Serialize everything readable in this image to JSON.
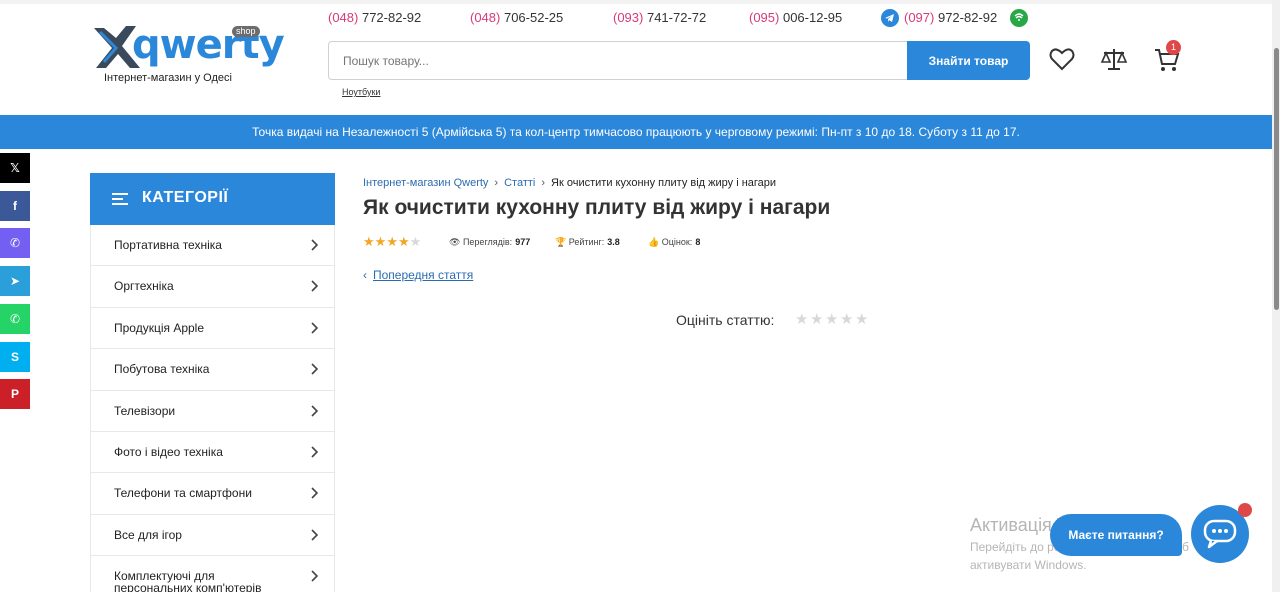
{
  "header": {
    "logo_text": "qwerty",
    "logo_badge": "shop",
    "logo_tagline": "Інтернет-магазин у Одесі",
    "phones": [
      {
        "code": "(048)",
        "number": " 772-82-92"
      },
      {
        "code": "(048)",
        "number": " 706-52-25"
      },
      {
        "code": "(093)",
        "number": " 741-72-72"
      },
      {
        "code": "(095)",
        "number": " 006-12-95"
      },
      {
        "code": "(097)",
        "number": " 972-82-92"
      }
    ],
    "search_placeholder": "Пошук товару...",
    "search_button": "Знайти товар",
    "search_hint": "Ноутбуки",
    "cart_count": "1",
    "icons": [
      "heart-icon",
      "compare-scales-icon",
      "cart-icon",
      "telegram-icon",
      "viber-icon"
    ]
  },
  "banner": "Точка видачі на Незалежності 5 (Армійська 5) та кол-центр тимчасово працюють у черговому режимі: Пн-пт з 10 до 18. Суботу з 11 до 17.",
  "share": [
    {
      "icon": "x-icon",
      "glyph": "𝕏",
      "color": "#000000"
    },
    {
      "icon": "facebook-icon",
      "glyph": "f",
      "color": "#3b5998"
    },
    {
      "icon": "viber-icon",
      "glyph": "✆",
      "color": "#7360f2"
    },
    {
      "icon": "telegram-icon",
      "glyph": "➤",
      "color": "#2b9fd9"
    },
    {
      "icon": "whatsapp-icon",
      "glyph": "✆",
      "color": "#25d366"
    },
    {
      "icon": "skype-icon",
      "glyph": "S",
      "color": "#00aff0"
    },
    {
      "icon": "pinterest-icon",
      "glyph": "P",
      "color": "#cb2027"
    }
  ],
  "categories": {
    "title": "КАТЕГОРІЇ",
    "items": [
      "Портативна техніка",
      "Оргтехніка",
      "Продукція Apple",
      "Побутова техніка",
      "Телевізори",
      "Фото і відео техніка",
      "Телефони та смартфони",
      "Все для ігор",
      "Комплектуючі для персональних комп'ютерів"
    ]
  },
  "breadcrumbs": [
    "Інтернет-магазин Qwerty",
    "Статті",
    "Як очистити кухонну плиту від жиру і нагари"
  ],
  "article": {
    "title": "Як очистити кухонну плиту від жиру і нагари",
    "rating_stars": 4,
    "views_label": "Переглядів:",
    "views": "977",
    "rating_label": "Рейтинг:",
    "rating": "3.8",
    "votes_label": "Оцінок:",
    "votes": "8",
    "prev_link": "Попередня стаття",
    "rate_label": "Оцініть статтю:"
  },
  "watermark": {
    "line1": "Активація Windows",
    "line2": "Перейдіть до розділу \"Настройки\", щоб",
    "line3": "активувати Windows."
  },
  "chat": {
    "label": "Маєте питання?"
  },
  "colors": {
    "accent": "#2b87d9",
    "phone_code": "#d83a7a",
    "star": "#f2a623",
    "badge": "#e04848"
  }
}
